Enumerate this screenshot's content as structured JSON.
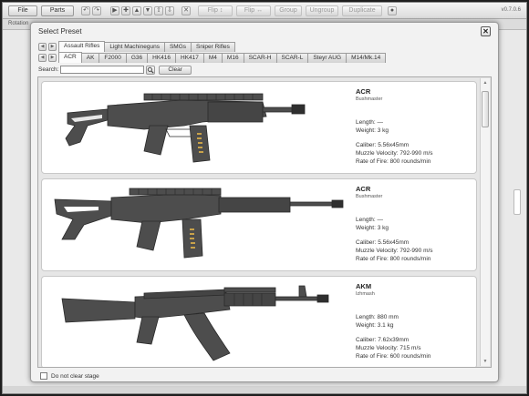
{
  "toolbar": {
    "file_label": "File",
    "parts_label": "Parts",
    "flip_v_label": "Flip ↕",
    "flip_h_label": "Flip ↔",
    "group_label": "Group",
    "ungroup_label": "Ungroup",
    "duplicate_label": "Duplicate",
    "version": "v0.7.0.6",
    "rotation_label": "Rotation"
  },
  "dialog": {
    "title": "Select Preset",
    "close_glyph": "✕"
  },
  "category_tabs": [
    {
      "label": "Assault Rifles",
      "active": true
    },
    {
      "label": "Light Machineguns",
      "active": false
    },
    {
      "label": "SMGs",
      "active": false
    },
    {
      "label": "Sniper Rifles",
      "active": false
    }
  ],
  "model_tabs": [
    {
      "label": "ACR",
      "active": true
    },
    {
      "label": "AK",
      "active": false
    },
    {
      "label": "F2000",
      "active": false
    },
    {
      "label": "G36",
      "active": false
    },
    {
      "label": "HK416",
      "active": false
    },
    {
      "label": "HK417",
      "active": false
    },
    {
      "label": "M4",
      "active": false
    },
    {
      "label": "M16",
      "active": false
    },
    {
      "label": "SCAR-H",
      "active": false
    },
    {
      "label": "SCAR-L",
      "active": false
    },
    {
      "label": "Steyr AUG",
      "active": false
    },
    {
      "label": "M14/Mk.14",
      "active": false
    }
  ],
  "search": {
    "label": "Search:",
    "value": "",
    "placeholder": "",
    "clear_label": "Clear"
  },
  "presets": [
    {
      "name": "ACR",
      "maker": "Bushmaster",
      "length": "Length: —",
      "weight": "Weight: 3 kg",
      "caliber": "Caliber: 5.56x45mm",
      "velocity": "Muzzle Velocity: 792-990 m/s",
      "rate": "Rate of Fire: 800 rounds/min"
    },
    {
      "name": "ACR",
      "maker": "Bushmaster",
      "length": "Length: —",
      "weight": "Weight: 3 kg",
      "caliber": "Caliber: 5.56x45mm",
      "velocity": "Muzzle Velocity: 792-990 m/s",
      "rate": "Rate of Fire: 800 rounds/min"
    },
    {
      "name": "AKM",
      "maker": "Izhmash",
      "length": "Length: 880 mm",
      "weight": "Weight: 3.1 kg",
      "caliber": "Caliber: 7.62x39mm",
      "velocity": "Muzzle Velocity: 715 m/s",
      "rate": "Rate of Fire: 600 rounds/min"
    }
  ],
  "footer": {
    "checkbox_label": "Do not clear stage",
    "checked": false
  },
  "icons": {
    "search": "search-icon",
    "close": "close-icon",
    "arrow_left": "arrow-left-icon",
    "arrow_right": "arrow-right-icon"
  },
  "colors": {
    "rifle_body": "#4d4d4d",
    "rifle_dark": "#2f2f2f",
    "magazine_rounds": "#c8a24a"
  }
}
